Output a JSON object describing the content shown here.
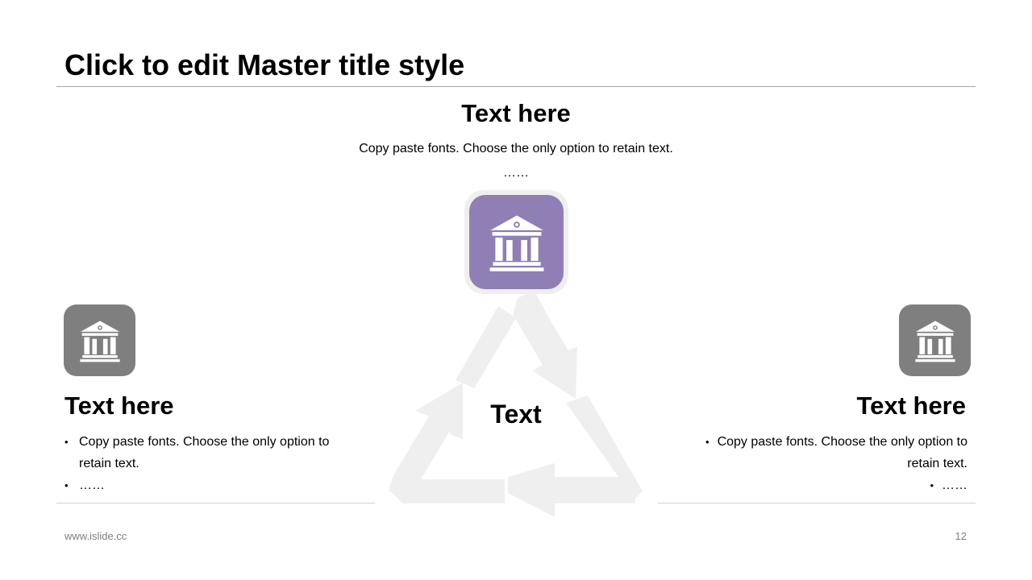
{
  "slide": {
    "title": "Click to edit Master title style"
  },
  "top_item": {
    "heading": "Text here",
    "body": "Copy paste fonts. Choose the only option to retain text.",
    "dots": "……",
    "icon": "museum-icon",
    "color": "#8f7fb5"
  },
  "center": {
    "label": "Text"
  },
  "left_item": {
    "heading": "Text here",
    "bullets": [
      "Copy paste fonts. Choose the only option to retain text.",
      "……"
    ],
    "icon": "museum-icon",
    "color": "#7f7f7f"
  },
  "right_item": {
    "heading": "Text here",
    "bullets": [
      "Copy paste fonts. Choose the only option to retain text.",
      "……"
    ],
    "icon": "museum-icon",
    "color": "#7f7f7f"
  },
  "footer": {
    "url": "www.islide.cc",
    "page_number": "12"
  }
}
